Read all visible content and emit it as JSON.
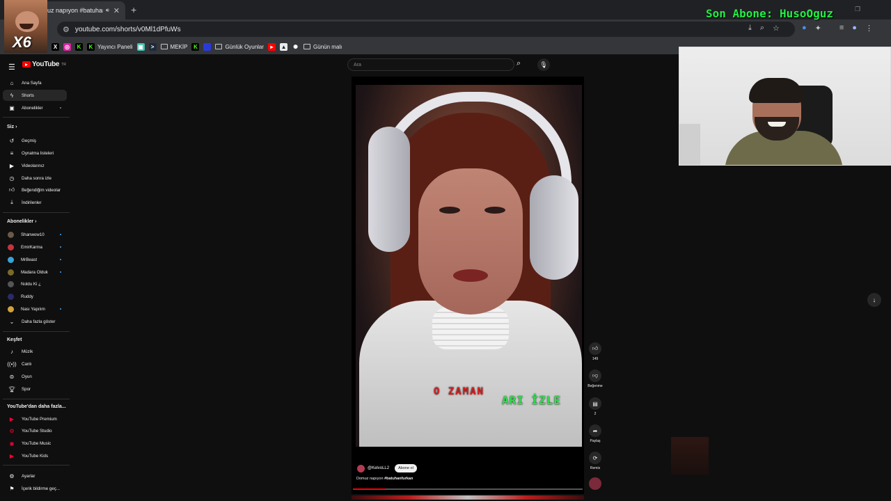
{
  "browser": {
    "tab_title": "uz napıyon #batuhanf",
    "url": "youtube.com/shorts/v0Ml1dPfuWs",
    "bookmarks": [
      {
        "label": "Yayıncı Paneli",
        "icon": "kick-icon",
        "color": "#53fc18"
      },
      {
        "label": "MEKİP",
        "icon": "folder-icon"
      },
      {
        "label": "Günlük Oyunlar",
        "icon": "folder-icon"
      },
      {
        "label": "Günün malı",
        "icon": "folder-icon"
      }
    ]
  },
  "overlay": {
    "son_abone": "Son Abone: HusoOguz",
    "avatar_badge": "X6"
  },
  "youtube": {
    "logo": "YouTube",
    "logo_sup": "TR",
    "search_placeholder": "Ara",
    "sidebar": {
      "main": [
        {
          "label": "Ana Sayfa",
          "icon": "home-icon"
        },
        {
          "label": "Shorts",
          "icon": "shorts-icon",
          "active": true
        },
        {
          "label": "Abonelikler",
          "icon": "subscriptions-icon",
          "dot": true
        }
      ],
      "you_heading": "Siz",
      "you": [
        {
          "label": "Geçmiş",
          "icon": "history-icon"
        },
        {
          "label": "Oynatma listeleri",
          "icon": "playlist-icon"
        },
        {
          "label": "Videolarınız",
          "icon": "your-videos-icon"
        },
        {
          "label": "Daha sonra izle",
          "icon": "watch-later-icon"
        },
        {
          "label": "Beğendiğim videolar",
          "icon": "like-icon"
        },
        {
          "label": "İndirilenler",
          "icon": "download-icon"
        }
      ],
      "subs_heading": "Abonelikler",
      "subs": [
        {
          "label": "Shanwow10",
          "color": "#6b5a4a"
        },
        {
          "label": "EmirKarma",
          "color": "#c8323c",
          "dot": true
        },
        {
          "label": "MrBeast",
          "color": "#3aa3d8",
          "dot": true
        },
        {
          "label": "Madara Olduk",
          "color": "#7a6a2c",
          "dot": true
        },
        {
          "label": "Noldu Ki ¿",
          "color": "#555555"
        },
        {
          "label": "Ruddy",
          "color": "#2b2b6b"
        },
        {
          "label": "Nası Yapılım",
          "color": "#d2a33a",
          "dot": true
        }
      ],
      "show_more": "Daha fazla göster",
      "explore_heading": "Keşfet",
      "explore": [
        {
          "label": "Müzik",
          "icon": "music-icon"
        },
        {
          "label": "Canlı",
          "icon": "live-icon"
        },
        {
          "label": "Oyun",
          "icon": "gaming-icon"
        },
        {
          "label": "Spor",
          "icon": "trophy-icon"
        }
      ],
      "more_heading": "YouTube'dan daha fazla...",
      "more": [
        {
          "label": "YouTube Premium"
        },
        {
          "label": "YouTube Studio"
        },
        {
          "label": "YouTube Music"
        },
        {
          "label": "YouTube Kids"
        }
      ],
      "settings": [
        {
          "label": "Ayarlar",
          "icon": "gear-icon"
        },
        {
          "label": "İçerik bildirme geç...",
          "icon": "flag-icon"
        }
      ]
    },
    "short": {
      "caption_red": "O ZAMAN",
      "caption_green": "ARI İZLE",
      "channel": "@KelvoLL2",
      "subscribe": "Abone ol",
      "description_prefix": "Domuz napıyon ",
      "description_tag": "#batuhanfurkan",
      "progress": 0.14
    },
    "actions": {
      "like_count": "149",
      "dislike_label": "Beğenme",
      "comment_count": "2",
      "share_label": "Paylaş",
      "remix_label": "Remix"
    }
  }
}
